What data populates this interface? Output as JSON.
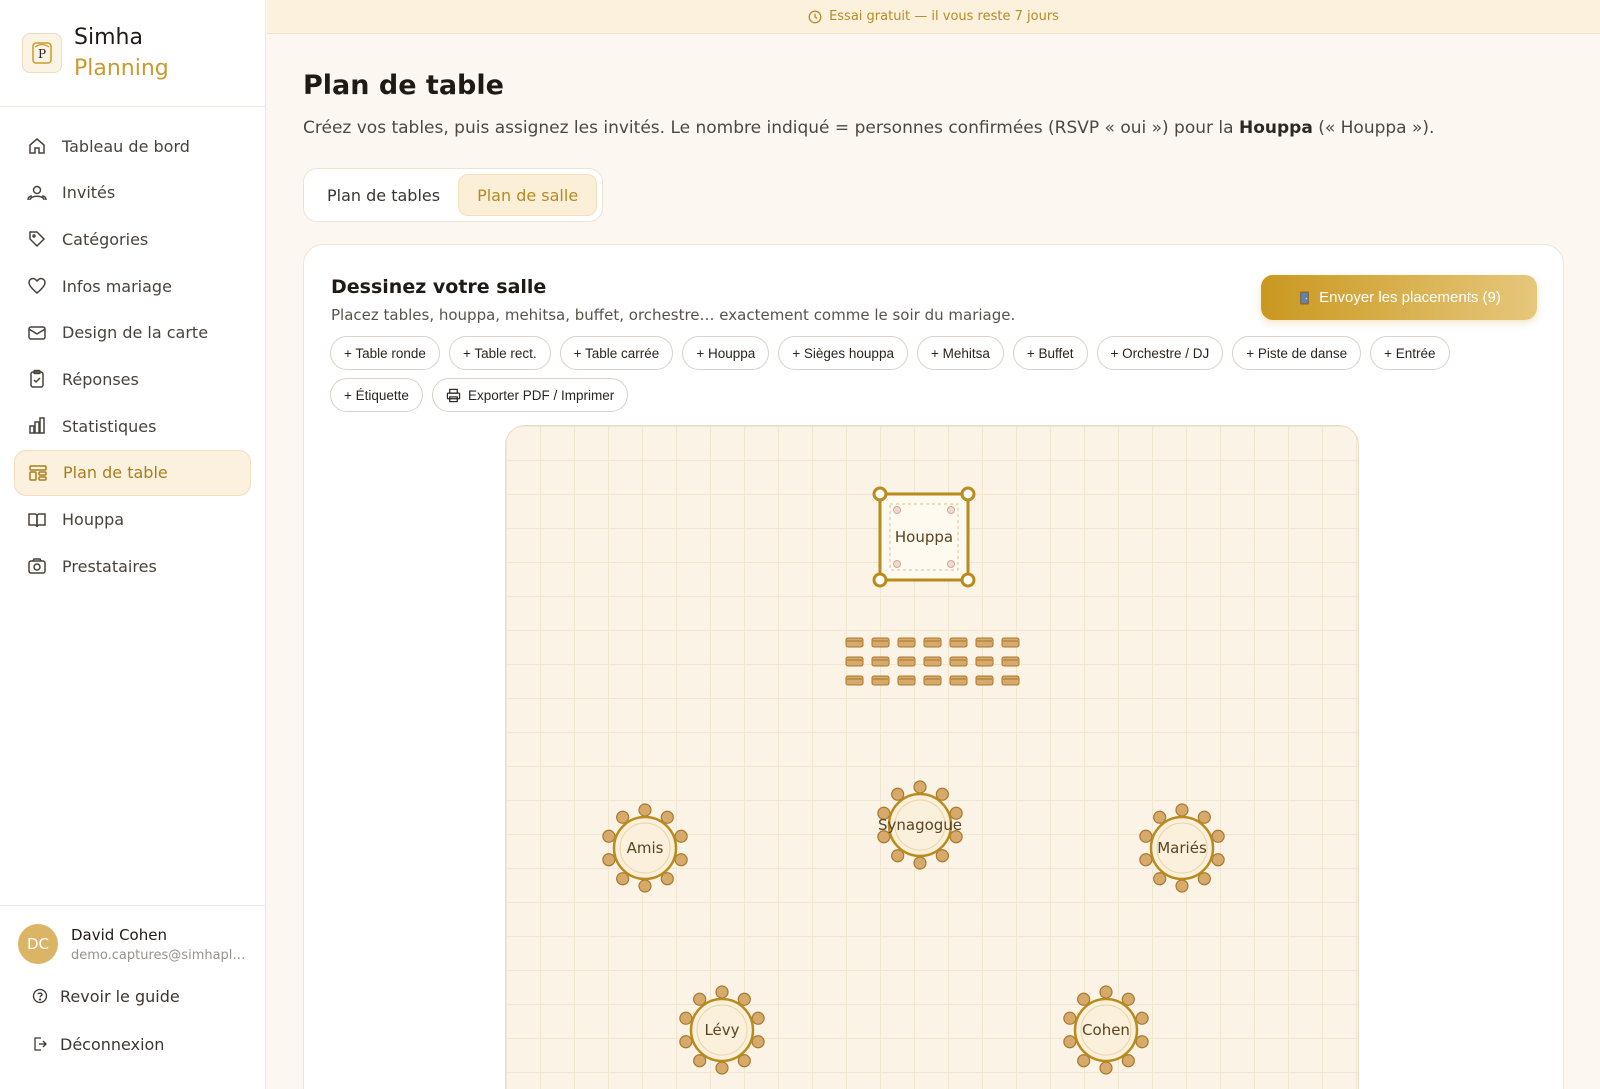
{
  "app": {
    "name_line1": "Simha",
    "name_line2": "Planning",
    "accent": "#c99a2e"
  },
  "trial": {
    "text": "Essai gratuit — il vous reste 7 jours"
  },
  "sidebar": {
    "items": [
      {
        "label": "Tableau de bord",
        "icon": "home-icon"
      },
      {
        "label": "Invités",
        "icon": "users-icon"
      },
      {
        "label": "Catégories",
        "icon": "tag-icon"
      },
      {
        "label": "Infos mariage",
        "icon": "heart-icon"
      },
      {
        "label": "Design de la carte",
        "icon": "mail-icon"
      },
      {
        "label": "Réponses",
        "icon": "clipboard-icon"
      },
      {
        "label": "Statistiques",
        "icon": "bar-chart-icon"
      },
      {
        "label": "Plan de table",
        "icon": "layout-icon",
        "active": true
      },
      {
        "label": "Houppa",
        "icon": "book-icon"
      },
      {
        "label": "Prestataires",
        "icon": "camera-icon"
      }
    ]
  },
  "user": {
    "initials": "DC",
    "name": "David Cohen",
    "email": "demo.captures@simhaplanning.com"
  },
  "footer": {
    "guide": "Revoir le guide",
    "logout": "Déconnexion"
  },
  "page": {
    "title": "Plan de table",
    "subtitle_pre": "Créez vos tables, puis assignez les invités. Le nombre indiqué = personnes confirmées (RSVP « oui ») pour la ",
    "subtitle_bold": "Houppa",
    "subtitle_post": " (« Houppa »).",
    "tabs": [
      "Plan de tables",
      "Plan de salle"
    ]
  },
  "card": {
    "title": "Dessinez votre salle",
    "subtitle": "Placez tables, houppa, mehitsa, buffet, orchestre… exactement comme le soir du mariage.",
    "send_button": "Envoyer les placements (9)",
    "tools_row1": [
      "+ Table ronde",
      "+ Table rect.",
      "+ Table carrée",
      "+ Houppa",
      "+ Sièges houppa",
      "+ Mehitsa",
      "+ Buffet",
      "+ Orchestre / DJ",
      "+ Piste de danse",
      "+ Entrée"
    ],
    "tools_row2_label": "+ Étiquette",
    "export_button": "Exporter PDF / Imprimer"
  },
  "floor": {
    "houppa_label": "Houppa",
    "tables": [
      {
        "label": "Amis",
        "seats": 10
      },
      {
        "label": "Synagogue",
        "seats": 10
      },
      {
        "label": "Mariés",
        "seats": 10
      },
      {
        "label": "Lévy",
        "seats": 10
      },
      {
        "label": "Cohen",
        "seats": 10
      }
    ],
    "houppa_seat_rows": 3,
    "houppa_seat_cols": 7
  }
}
